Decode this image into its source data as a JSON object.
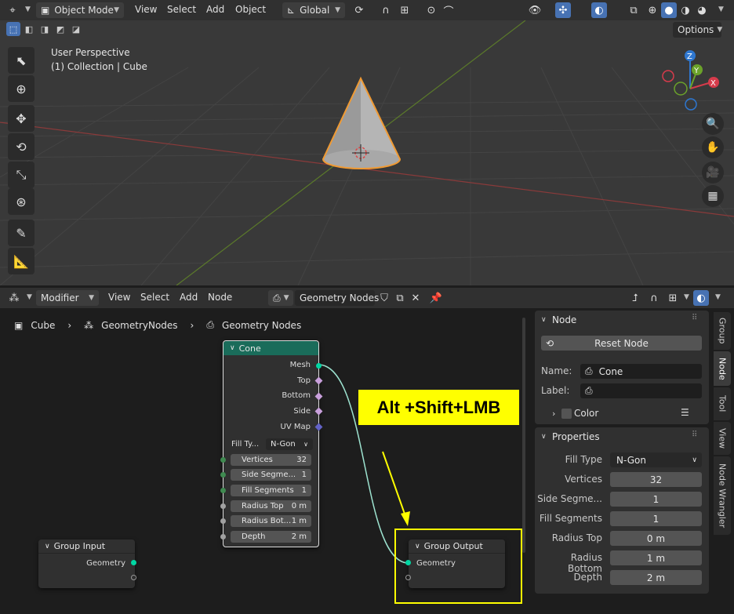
{
  "viewport_header": {
    "mode_label": "Object Mode",
    "menus": [
      "View",
      "Select",
      "Add",
      "Object"
    ],
    "transform_orientation": "Global",
    "options_label": "Options"
  },
  "viewport": {
    "perspective_label": "User Perspective",
    "collection_label": "(1) Collection | Cube"
  },
  "node_header": {
    "mode_label": "Modifier",
    "menus": [
      "View",
      "Select",
      "Add",
      "Node"
    ],
    "tree_name": "Geometry Nodes"
  },
  "breadcrumb": [
    "Cube",
    "GeometryNodes",
    "Geometry Nodes"
  ],
  "annotation": {
    "text": "Alt +Shift+LMB",
    "color": "#ffff00"
  },
  "nodes": {
    "cone": {
      "title": "Cone",
      "header_color": "#1a6c5a",
      "outputs": [
        "Mesh",
        "Top",
        "Bottom",
        "Side",
        "UV Map"
      ],
      "fill_type_label": "Fill Ty...",
      "fill_type_value": "N-Gon",
      "inputs": [
        {
          "label": "Vertices",
          "value": "32"
        },
        {
          "label": "Side Segme...",
          "value": "1"
        },
        {
          "label": "Fill Segments",
          "value": "1"
        },
        {
          "label": "Radius Top",
          "value": "0 m"
        },
        {
          "label": "Radius Bot...",
          "value": "1 m"
        },
        {
          "label": "Depth",
          "value": "2 m"
        }
      ]
    },
    "group_input": {
      "title": "Group Input",
      "socket": "Geometry"
    },
    "group_output": {
      "title": "Group Output",
      "socket": "Geometry"
    }
  },
  "properties": {
    "node_panel_title": "Node",
    "reset_label": "Reset Node",
    "name_label": "Name:",
    "name_value": "Cone",
    "label_label": "Label:",
    "label_value": "",
    "color_label": "Color",
    "props_panel_title": "Properties",
    "rows": [
      {
        "label": "Fill Type",
        "value": "N-Gon"
      },
      {
        "label": "Vertices",
        "value": "32"
      },
      {
        "label": "Side Segme...",
        "value": "1"
      },
      {
        "label": "Fill Segments",
        "value": "1"
      },
      {
        "label": "Radius Top",
        "value": "0 m"
      },
      {
        "label": "Radius Bottom",
        "value": "1 m"
      },
      {
        "label": "Depth",
        "value": "2 m"
      }
    ]
  },
  "sidebar_tabs": [
    "Group",
    "Node",
    "Tool",
    "View",
    "Node Wrangler"
  ]
}
